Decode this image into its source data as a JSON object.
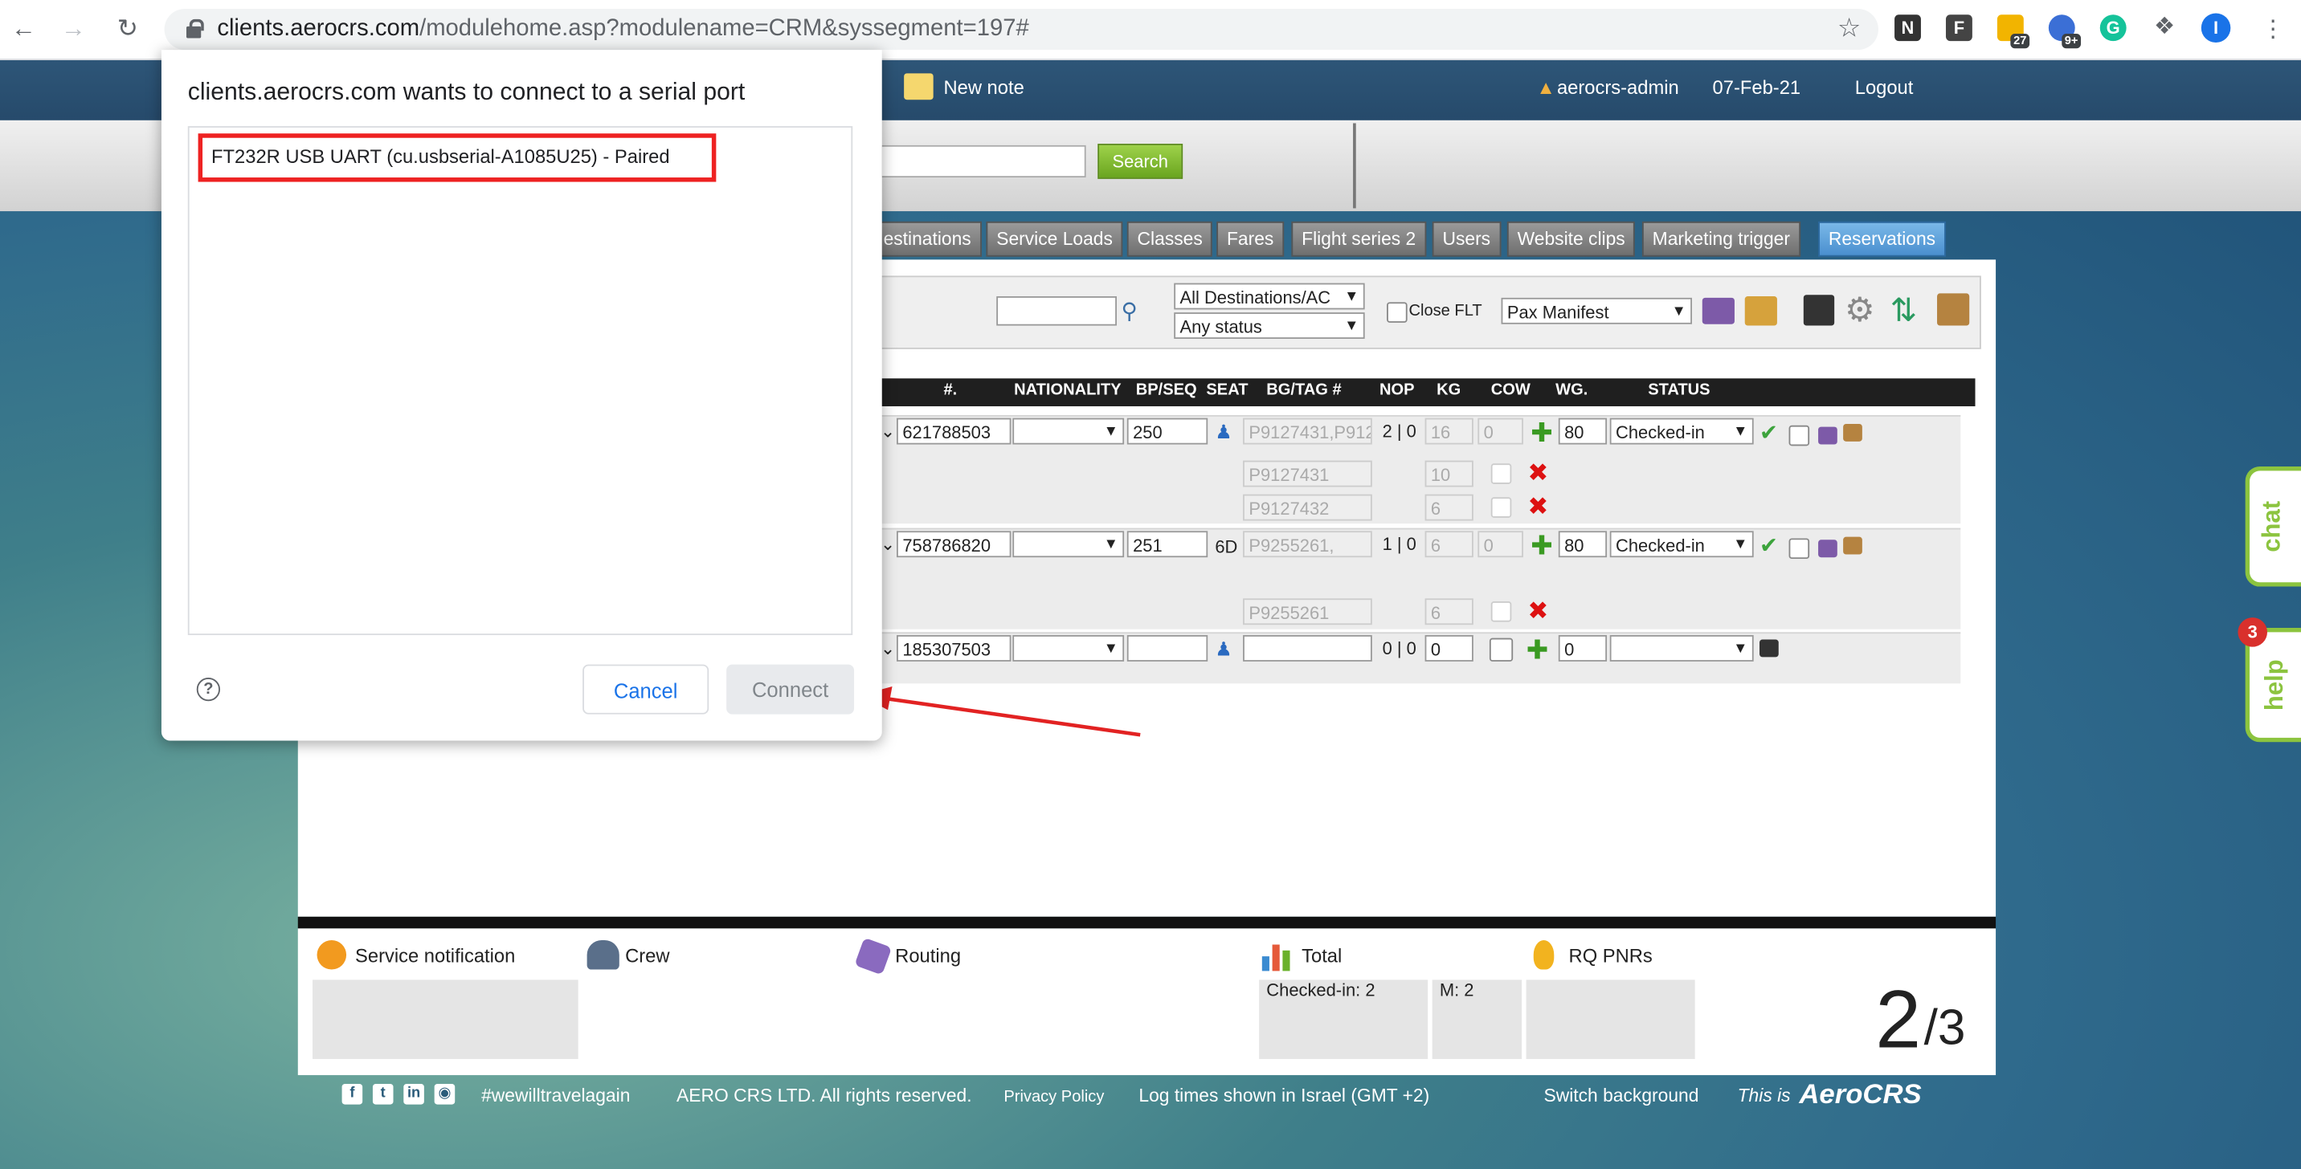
{
  "browser": {
    "url_host": "clients.aerocrs.com",
    "url_path": "/modulehome.asp?modulename=CRM&syssegment=197#",
    "extensions": [
      {
        "letter": "N",
        "color": "#333333"
      },
      {
        "letter": "F",
        "color": "#444444"
      },
      {
        "letter": "",
        "color": "#f2b400",
        "badge": "27"
      },
      {
        "letter": "",
        "color": "#3b6fd6",
        "badge": "9+"
      },
      {
        "letter": "G",
        "color": "#15c39a"
      },
      {
        "letter": "",
        "color": "#5f6368"
      },
      {
        "letter": "I",
        "color": "#1a73e8"
      }
    ]
  },
  "topbar": {
    "new_note": "New note",
    "user": "aerocrs-admin",
    "date": "07-Feb-21",
    "logout": "Logout"
  },
  "search": {
    "button": "Search"
  },
  "tabs": [
    "estinations",
    "Service Loads",
    "Classes",
    "Fares",
    "Flight series 2",
    "Users",
    "Website clips",
    "Marketing trigger",
    "Reservations"
  ],
  "filters": {
    "destinations": "All Destinations/AC",
    "status": "Any status",
    "close_flt": "Close FLT",
    "report": "Pax Manifest"
  },
  "table": {
    "headers": [
      "#.",
      "NATIONALITY",
      "BP/SEQ",
      "SEAT",
      "BG/TAG #",
      "NOP",
      "KG",
      "COW",
      "WG.",
      "STATUS"
    ],
    "rows": [
      {
        "ticket": "621788503",
        "bp": "250",
        "seat": "",
        "tags": "P9127431,P912",
        "nop": "2 | 0",
        "kg": "16",
        "cow": "0",
        "wg": "80",
        "status": "Checked-in",
        "subtags": [
          {
            "tag": "P9127431",
            "kg": "10"
          },
          {
            "tag": "P9127432",
            "kg": "6"
          }
        ]
      },
      {
        "ticket": "758786820",
        "bp": "251",
        "seat": "6D",
        "tags": "P9255261,",
        "nop": "1 | 0",
        "kg": "6",
        "cow": "0",
        "wg": "80",
        "status": "Checked-in",
        "subtags": [
          {
            "tag": "P9255261",
            "kg": "6"
          }
        ]
      },
      {
        "ticket": "185307503",
        "bp": "",
        "seat": "",
        "tags": "",
        "nop": "0 | 0",
        "kg": "0",
        "cow": "",
        "wg": "0",
        "status": "",
        "subtags": []
      }
    ]
  },
  "lower": {
    "service_notification": "Service notification",
    "crew": "Crew",
    "routing": "Routing",
    "total": "Total",
    "rq_pnrs": "RQ PNRs",
    "checked_in": "Checked-in: 2",
    "m": "M: 2",
    "page_current": "2",
    "page_total": "/3"
  },
  "footer": {
    "hashtag": "#wewilltravelagain",
    "rights": "AERO CRS LTD. All rights reserved.",
    "privacy": "Privacy Policy",
    "log_times": "Log times shown in Israel (GMT +2)",
    "switch_bg": "Switch background",
    "this_is": "This is",
    "brand": "AeroCRS"
  },
  "side": {
    "chat": "chat",
    "help": "help",
    "help_badge": "3"
  },
  "dialog": {
    "title": "clients.aerocrs.com wants to connect to a serial port",
    "device": "FT232R USB UART (cu.usbserial-A1085U25) - Paired",
    "cancel": "Cancel",
    "connect": "Connect",
    "help": "?"
  },
  "colors": {
    "highlight_red": "#e22222",
    "accent_green": "#8cc43f",
    "chrome_blue": "#1a73e8"
  }
}
